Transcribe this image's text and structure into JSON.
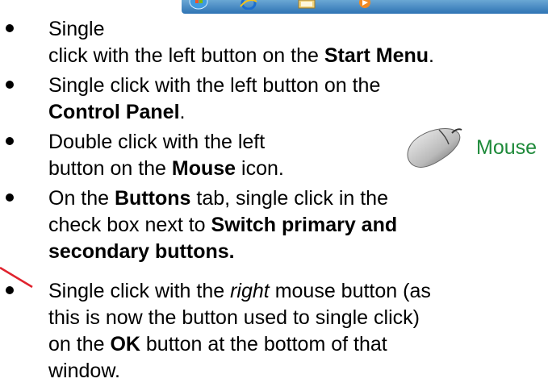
{
  "mouse_icon_label": "Mouse",
  "bullets": [
    {
      "line1": "Single",
      "line2_pre": "click with the left button on the ",
      "line2_bold": "Start Menu",
      "line2_post": "."
    },
    {
      "line1": "Single click with the left button on the",
      "line2_bold": "Control Panel",
      "line2_post": "."
    },
    {
      "line1": "Double click with the left",
      "line2_pre": "button on the ",
      "line2_bold": "Mouse",
      "line2_post": " icon."
    },
    {
      "line1_pre": "On the ",
      "line1_bold": "Buttons",
      "line1_post": " tab, single click in the",
      "line2_pre": "check box next to ",
      "line2_bold": "Switch primary and",
      "line3_bold": "secondary buttons."
    },
    {
      "line1_pre": "Single click with the ",
      "line1_italic": "right",
      "line1_post": " mouse button (as",
      "line2": "this is now the button used to single click)",
      "line3_pre": "on the ",
      "line3_bold": "OK",
      "line3_post": " button at the bottom of that",
      "line4": "window."
    }
  ],
  "colors": {
    "taskbar": "#2e73b4",
    "mouse_label": "#1e8a3a",
    "pointer_line": "#e0232e"
  }
}
